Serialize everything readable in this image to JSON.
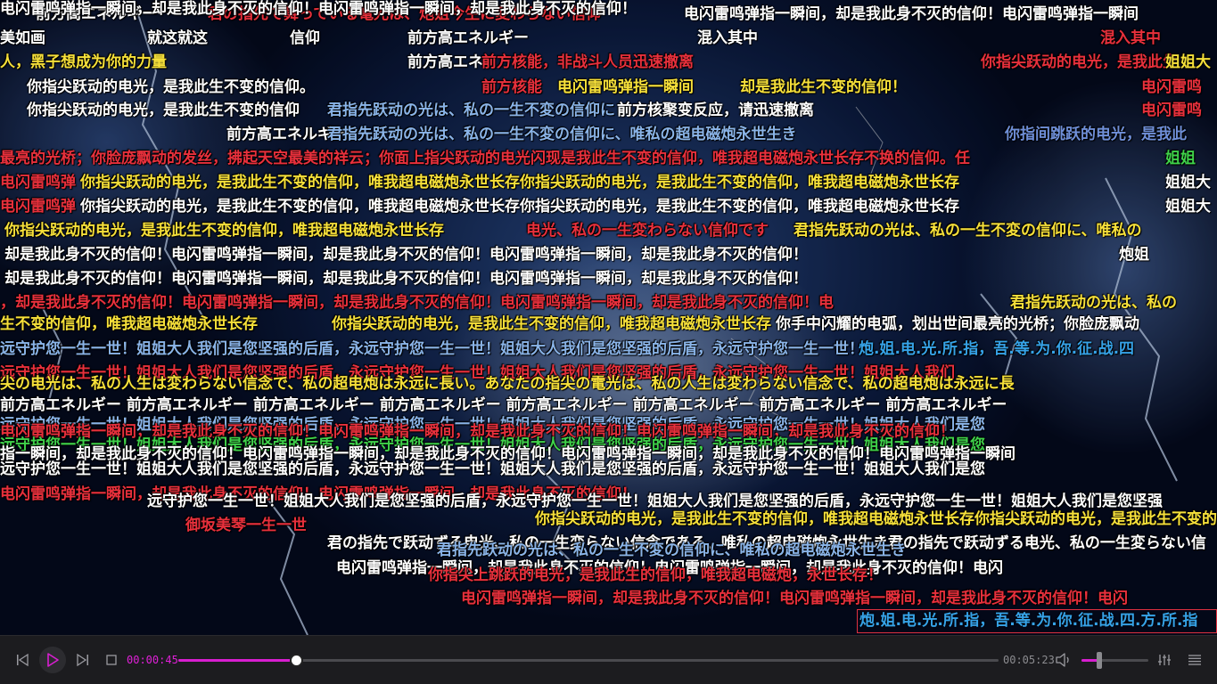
{
  "player": {
    "current_time": "00:00:45",
    "total_time": "00:05:23",
    "progress": 0.143,
    "volume": 0.27,
    "accent_color": "#e020d8",
    "state": "paused"
  },
  "icons": {
    "prev": "skip-previous-icon",
    "play": "play-icon",
    "next": "skip-next-icon",
    "stop": "stop-icon",
    "volume": "volume-icon",
    "equalizer": "equalizer-icon",
    "playlist": "playlist-icon"
  },
  "highlighted_danmaku": "炮.姐.电.光.所.指，吾.等.为.你.征.战.四.方.所.指",
  "danmaku": [
    {
      "text": "前方高エネルギー",
      "color": "#ffffff"
    },
    {
      "text": "君の指先で舞っている電光は、炮姐今生に変わらない信仰",
      "color": "#e8303c"
    },
    {
      "text": "电闪雷鸣弹指一瞬间，却是我此身不灭的信仰！电闪雷鸣弹指一瞬间",
      "color": "#ffffff"
    },
    {
      "text": "美如画",
      "color": "#ffffff"
    },
    {
      "text": "就这就这",
      "color": "#ffffff"
    },
    {
      "text": "信仰",
      "color": "#ffffff"
    },
    {
      "text": "前方高エネルギー",
      "color": "#ffffff"
    },
    {
      "text": "混入其中",
      "color": "#ffffff"
    },
    {
      "text": "混入其中",
      "color": "#e8303c"
    },
    {
      "text": "人，黑子想成为你的力量",
      "color": "#f6e03a"
    },
    {
      "text": "前方高エネ",
      "color": "#ffffff"
    },
    {
      "text": "前方核能，非战斗人员迅速撤离",
      "color": "#e8303c"
    },
    {
      "text": "你指尖跃动的电光，是我此生",
      "color": "#e8303c"
    },
    {
      "text": "姐姐大",
      "color": "#f6e03a"
    },
    {
      "text": "你指尖跃动的电光，是我此生不变的信仰。",
      "color": "#ffffff"
    },
    {
      "text": "前方核能",
      "color": "#e8303c"
    },
    {
      "text": "电闪雷鸣弹指一瞬间",
      "color": "#f6e03a"
    },
    {
      "text": "却是我此生不变的信仰！",
      "color": "#f6e03a"
    },
    {
      "text": "电闪雷鸣",
      "color": "#e8303c"
    },
    {
      "text": "你指尖跃动的电光，是我此生不变的信仰",
      "color": "#ffffff"
    },
    {
      "text": "君指先跃动の光は、私の一生不変の信仰に",
      "color": "#8ab4e8"
    },
    {
      "text": "前方核聚变反应，请迅速撤离",
      "color": "#ffffff"
    },
    {
      "text": "电闪雷鸣",
      "color": "#e8303c"
    },
    {
      "text": "前方高エネルギー",
      "color": "#ffffff"
    },
    {
      "text": "君指先跃动の光は、私の一生不変の信仰に、唯私の超电磁炮永世生き",
      "color": "#8ab4e8"
    },
    {
      "text": "你指间跳跃的电光，是我此",
      "color": "#6f8fd8"
    },
    {
      "text": "最亮的光桥；你脸庞飘动的发丝，拂起天空最美的祥云；你面上指尖跃动的电光闪现是我此生不变的信仰，唯我超电磁炮永世长存不换的信仰。任",
      "color": "#e8303c"
    },
    {
      "text": "姐姐",
      "color": "#3fd24a"
    },
    {
      "text": "电闪雷鸣弹",
      "color": "#e8303c"
    },
    {
      "text": "你指尖跃动的电光，是我此生不变的信仰，唯我超电磁炮永世长存你指尖跃动的电光，是我此生不变的信仰，唯我超电磁炮永世长存",
      "color": "#f6e03a"
    },
    {
      "text": "姐姐大",
      "color": "#ffffff"
    },
    {
      "text": "电闪雷鸣弹",
      "color": "#e8303c"
    },
    {
      "text": "你指尖跃动的电光，是我此生不变的信仰，唯我超电磁炮永世长存你指尖跃动的电光，是我此生不变的信仰，唯我超电磁炮永世长存",
      "color": "#ffffff"
    },
    {
      "text": "姐姐大",
      "color": "#ffffff"
    },
    {
      "text": "你指尖跃动的电光，是我此生不变的信仰，唯我超电磁炮永世长存",
      "color": "#f6e03a"
    },
    {
      "text": "电光、私の一生変わらない信仰です",
      "color": "#e8303c"
    },
    {
      "text": "君指先跃动の光は、私の一生不変の信仰に、唯私の",
      "color": "#f6e03a"
    },
    {
      "text": "却是我此身不灭的信仰！电闪雷鸣弹指一瞬间，却是我此身不灭的信仰！电闪雷鸣弹指一瞬间，却是我此身不灭的信仰！",
      "color": "#ffffff"
    },
    {
      "text": "炮姐",
      "color": "#ffffff"
    },
    {
      "text": "却是我此身不灭的信仰！电闪雷鸣弹指一瞬间，却是我此身不灭的信仰！电闪雷鸣弹指一瞬间，却是我此身不灭的信仰！",
      "color": "#ffffff"
    },
    {
      "text": "，却是我此身不灭的信仰！电闪雷鸣弹指一瞬间，却是我此身不灭的信仰！电闪雷鸣弹指一瞬间，却是我此身不灭的信仰！电",
      "color": "#e8303c"
    },
    {
      "text": "君指先跃动の光は、私の",
      "color": "#f6e03a"
    },
    {
      "text": "生不变的信仰，唯我超电磁炮永世长存",
      "color": "#f6e03a"
    },
    {
      "text": "你指尖跃动的电光，是我此生不变的信仰，唯我超电磁炮永世长存",
      "color": "#f6e03a"
    },
    {
      "text": "你手中闪耀的电弧，划出世间最亮的光桥；你脸庞飘动",
      "color": "#ffffff"
    },
    {
      "text": "远守护您一生一世！姐姐大人我们是您坚强的后盾，永远守护您一生一世！姐姐大人我们是您坚强的后盾，永远守护您一生一世！",
      "color": "#8ab4e8"
    },
    {
      "text": "炮.姐.电.光.所.指，吾.等.为.你.征.战.四",
      "color": "#36a3e8"
    },
    {
      "text": "远守护您一生一世！姐姐大人我们是您坚强的后盾，永远守护您一生一世！姐姐大人我们是您坚强的后盾，永远守护您一生一世！姐姐大人我们",
      "color": "#e8303c"
    },
    {
      "text": "尖の电光は、私の人生は変わらない信念で、私の超电炮は永远に長い。あなたの指尖の電光は、私の人生は変わらない信念で、私の超电炮は永远に長",
      "color": "#f6e03a"
    },
    {
      "text": "前方高エネルギー 前方高エネルギー 前方高エネルギー 前方高エネルギー 前方高エネルギー 前方高エネルギー 前方高エネルギー 前方高エネルギー",
      "color": "#ffffff"
    },
    {
      "text": "远守护您一生一世！姐姐大人我们是您坚强的后盾，永远守护您一生一世！姐姐大人我们是您坚强的后盾，永远守护您一生一世！姐姐大人我们是您",
      "color": "#8ab4e8"
    },
    {
      "text": "电闪雷鸣弹指一瞬间，却是我此身不灭的信仰！电闪雷鸣弹指一瞬间，却是我此身不灭的信仰！电闪雷鸣弹指一瞬间，却是我此身不灭的信仰！",
      "color": "#e8303c"
    },
    {
      "text": "远守护您一生一世！姐姐大人我们是您坚强的后盾，永远守护您一生一世！姐姐大人我们是您坚强的后盾，永远守护您一生一世！姐姐大人我们是您",
      "color": "#3fd24a"
    },
    {
      "text": "指一瞬间，却是我此身不灭的信仰！电闪雷鸣弹指一瞬间，却是我此身不灭的信仰！电闪雷鸣弹指一瞬间，却是我此身不灭的信仰！电闪雷鸣弹指一瞬间",
      "color": "#ffffff"
    },
    {
      "text": "远守护您一生一世！姐姐大人我们是您坚强的后盾，永远守护您一生一世！姐姐大人我们是您坚强的后盾，永远守护您一生一世！姐姐大人我们是您",
      "color": "#ffffff"
    },
    {
      "text": "电闪雷鸣弹指一瞬间，却是我此身不灭的信仰！电闪雷鸣弹指一瞬间，却是我此身不灭的信仰！",
      "color": "#e8303c"
    },
    {
      "text": "远守护您一生一世！姐姐大人我们是您坚强的后盾，永远守护您一生一世！姐姐大人我们是您坚强的后盾，永远守护您一生一世！姐姐大人我们是您坚强",
      "color": "#ffffff"
    },
    {
      "text": "你指尖跃动的电光，是我此生不变的信仰，唯我超电磁炮永世长存你指尖跃动的电光，是我此生不变的信仰，唯我超电磁炮永世长存",
      "color": "#f6e03a"
    },
    {
      "text": "御坂美琴一生一世",
      "color": "#e8303c"
    },
    {
      "text": "君の指先で跃动ずる电光、私の一生変らない信念である、唯私の超电磁炮永世生き君の指先で跃动ずる电光、私の一生変らない信",
      "color": "#ffffff"
    },
    {
      "text": "君指先跃动の光は、私の一生不変の信仰に、唯私の超电磁炮永世生き",
      "color": "#8ab4e8"
    },
    {
      "text": "电闪雷鸣弹指一瞬间，却是我此身不灭的信仰！电闪雷鸣弹指一瞬间，却是我此身不灭的信仰！电闪",
      "color": "#ffffff"
    },
    {
      "text": "你指尖上跳跃的电光，是我此生的信仰，唯我超电磁炮，永世长存！",
      "color": "#e8303c"
    },
    {
      "text": "电闪雷鸣弹指一瞬间，却是我此身不灭的信仰！电闪雷鸣弹指一瞬间，却是我此身不灭的信仰！电闪",
      "color": "#e8303c"
    },
    {
      "text": "电闪雷鸣弹指一瞬间，却是我此身不灭的信仰！电闪雷鸣弹指一瞬间，却是我此身不灭的信仰！",
      "color": "#ffffff"
    }
  ]
}
